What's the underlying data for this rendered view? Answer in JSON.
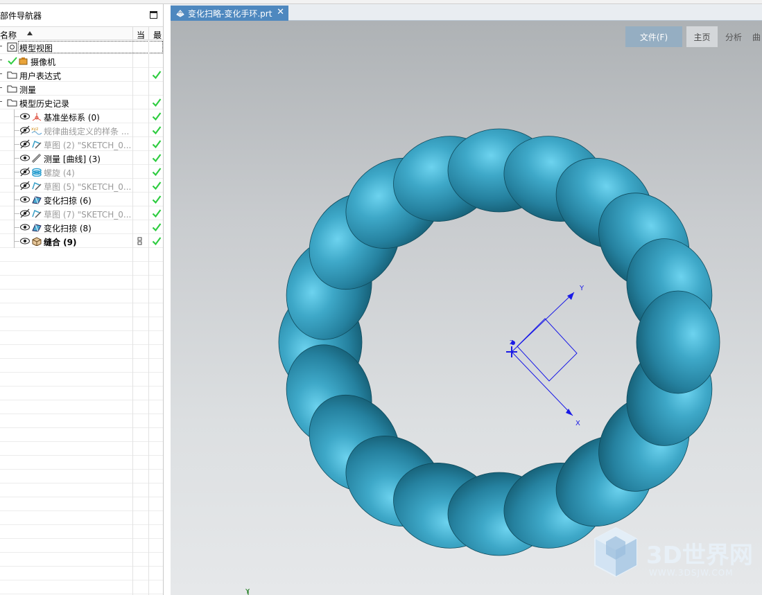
{
  "navigator": {
    "title": "部件导航器",
    "columns": {
      "name": "名称",
      "current": "当",
      "latest": "最"
    },
    "rows": [
      {
        "label": "模型视图",
        "icon": "model-view-icon",
        "style": "normal",
        "check": false
      },
      {
        "label": "摄像机",
        "icon": "camera-icon",
        "style": "normal",
        "check": false
      },
      {
        "label": "用户表达式",
        "icon": "folder-icon",
        "style": "normal",
        "check": true
      },
      {
        "label": "测量",
        "icon": "folder-icon",
        "style": "normal",
        "check": false
      },
      {
        "label": "模型历史记录",
        "icon": "folder-icon",
        "style": "normal",
        "check": true
      },
      {
        "label": "基准坐标系 (0)",
        "icon": "datum-csys-icon",
        "style": "normal",
        "check": true
      },
      {
        "label": "规律曲线定义的样条 ...",
        "icon": "law-curve-icon",
        "style": "dim",
        "check": true
      },
      {
        "label": "草图 (2) \"SKETCH_0...",
        "icon": "sketch-icon",
        "style": "dim",
        "check": true
      },
      {
        "label": "测量 [曲线] (3)",
        "icon": "measure-icon",
        "style": "normal",
        "check": true
      },
      {
        "label": "螺旋 (4)",
        "icon": "helix-icon",
        "style": "dim",
        "check": true
      },
      {
        "label": "草图 (5) \"SKETCH_0...",
        "icon": "sketch-icon",
        "style": "dim",
        "check": true
      },
      {
        "label": "变化扫掠 (6)",
        "icon": "variational-sweep-icon",
        "style": "normal",
        "check": true
      },
      {
        "label": "草图 (7) \"SKETCH_0...",
        "icon": "sketch-icon",
        "style": "dim",
        "check": true
      },
      {
        "label": "变化扫掠 (8)",
        "icon": "variational-sweep-icon",
        "style": "normal",
        "check": true
      },
      {
        "label": "缝合 (9)",
        "icon": "sew-icon",
        "style": "bold",
        "check": true
      }
    ]
  },
  "graphics": {
    "file_tab": "变化扫略-变化手环.prt",
    "ribbon": {
      "file": "文件(F)",
      "home": "主页",
      "analysis": "分析",
      "more": "曲"
    },
    "axes": {
      "y": "Y",
      "x": "X",
      "z": "Z",
      "corner_y": "Y"
    },
    "watermark": {
      "brand": "3D世界网",
      "url": "WWW.3DSJW.COM"
    }
  },
  "colors": {
    "part": "#2d8aa8",
    "check": "#2ecc40",
    "triad": "#1a1ae6",
    "tab": "#4e88bf"
  }
}
